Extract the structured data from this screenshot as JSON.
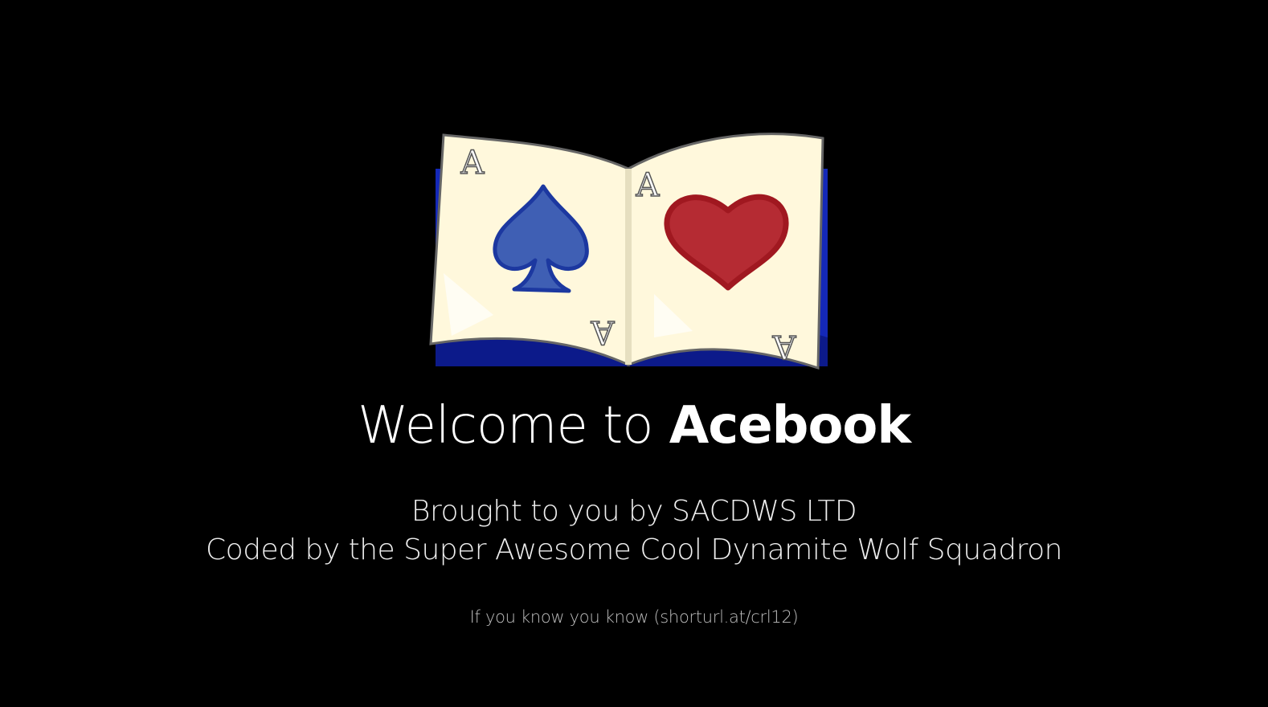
{
  "logo": {
    "icon": "open-book-aces-icon",
    "left_page_rank": "A",
    "right_page_rank": "A",
    "left_suit": "spade",
    "right_suit": "heart",
    "colors": {
      "cover": "#1428b8",
      "page": "#fff8dc",
      "spade": "#3f5fb4",
      "heart": "#b52b33"
    }
  },
  "welcome": {
    "prefix": "Welcome to",
    "brand": "Acebook"
  },
  "credits": {
    "line1": "Brought to you by SACDWS LTD",
    "line2": "Coded by the Super Awesome Cool Dynamite Wolf Squadron"
  },
  "footnote": "If you know you know (shorturl.at/crl12)",
  "colors": {
    "background": "#000000",
    "text": "#ffffff",
    "muted_text": "#bdbdbd"
  }
}
